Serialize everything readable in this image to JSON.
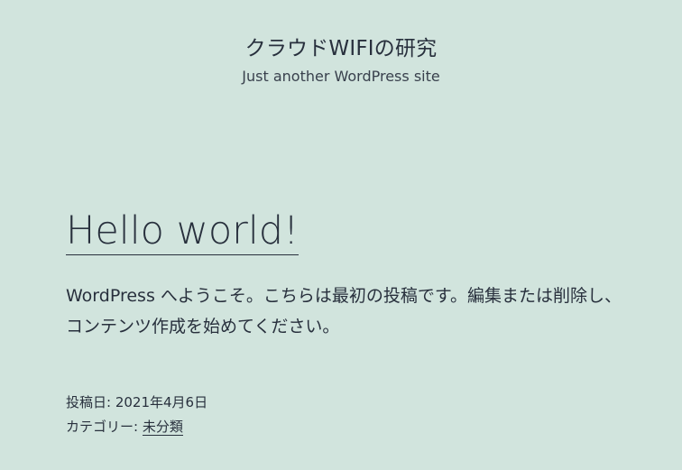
{
  "header": {
    "site_title": "クラウドWIFIの研究",
    "site_description": "Just another WordPress site"
  },
  "post": {
    "title": "Hello world!",
    "content": "WordPress へようこそ。こちらは最初の投稿です。編集または削除し、コンテンツ作成を始めてください。",
    "meta": {
      "posted_on_label": "投稿日: ",
      "posted_on_value": "2021年4月6日",
      "category_label": "カテゴリー: ",
      "category_value": "未分類"
    }
  },
  "colors": {
    "background": "#d1e4dd",
    "text": "#28303d"
  }
}
